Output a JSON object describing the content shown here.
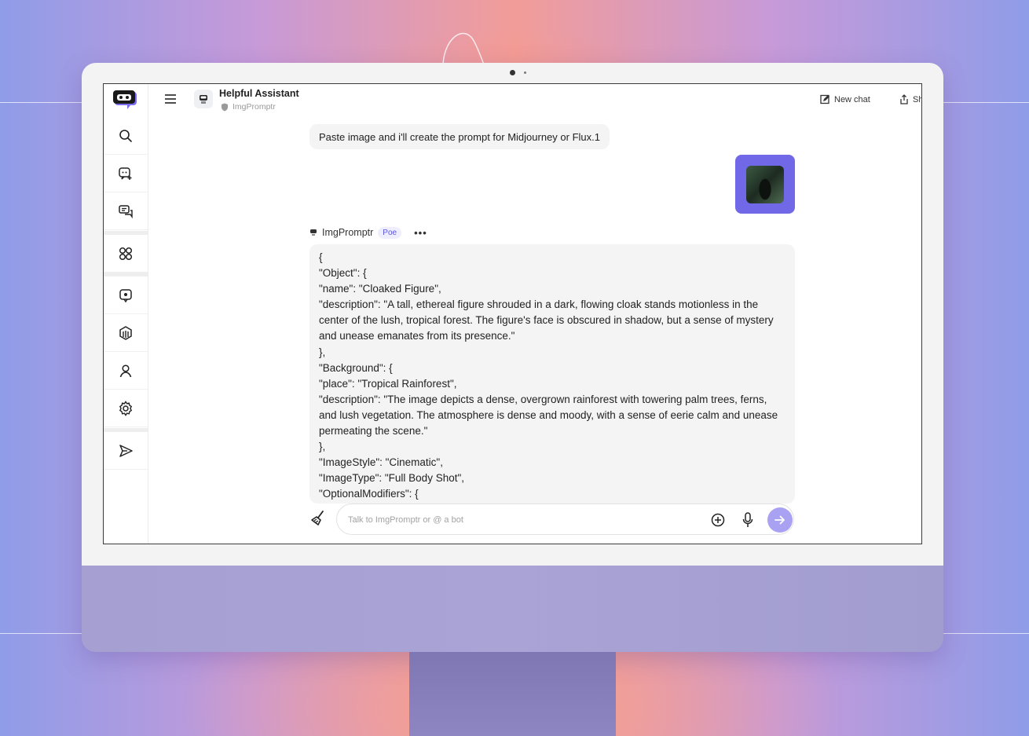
{
  "header": {
    "bot_title": "Helpful Assistant",
    "bot_subtitle": "ImgPromptr",
    "new_chat_label": "New chat",
    "share_label": "Share"
  },
  "sidebar": {
    "items": [
      {
        "icon": "search-icon"
      },
      {
        "icon": "create-bot-icon"
      },
      {
        "icon": "chats-icon"
      },
      {
        "icon": "explore-icon"
      },
      {
        "icon": "bot-icon"
      },
      {
        "icon": "cube-icon"
      },
      {
        "icon": "profile-icon"
      },
      {
        "icon": "gear-icon"
      },
      {
        "icon": "send-icon"
      }
    ]
  },
  "conversation": {
    "intro_message": "Paste image and i'll create the prompt for Midjourney or Flux.1",
    "reply_bot_name": "ImgPromptr",
    "reply_badge": "Poe",
    "reply_lines": [
      "{",
      "\"Object\": {",
      "\"name\": \"Cloaked Figure\",",
      "\"description\": \"A tall, ethereal figure shrouded in a dark, flowing cloak stands motionless in the center of the lush, tropical forest. The figure's face is obscured in shadow, but a sense of mystery and unease emanates from its presence.\"",
      "},",
      "\"Background\": {",
      "\"place\": \"Tropical Rainforest\",",
      "\"description\": \"The image depicts a dense, overgrown rainforest with towering palm trees, ferns, and lush vegetation. The atmosphere is dense and moody, with a sense of eerie calm and unease permeating the scene.\"",
      "},",
      "\"ImageStyle\": \"Cinematic\",",
      "\"ImageType\": \"Full Body Shot\",",
      "\"OptionalModifiers\": {"
    ]
  },
  "composer": {
    "placeholder": "Talk to ImgPromptr or @ a bot"
  },
  "colors": {
    "accent": "#7068e6",
    "send_button": "#a9a2f2",
    "bubble": "#f4f4f5"
  }
}
